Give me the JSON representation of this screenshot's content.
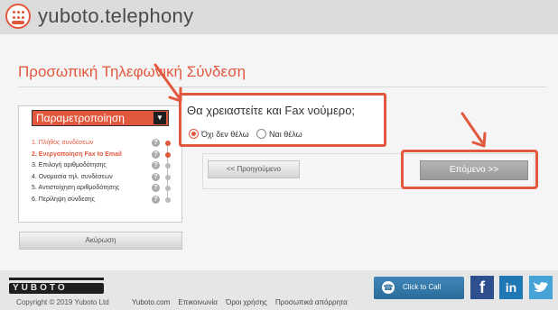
{
  "header": {
    "brand": "yuboto.telephony"
  },
  "page": {
    "title": "Προσωπική Τηλεφωνική Σύνδεση"
  },
  "sidebar": {
    "heading": "Παραμετροποίηση",
    "steps": [
      {
        "label": "1. Πλήθος συνδέσεων",
        "state": "done"
      },
      {
        "label": "2. Ενεργοποίηση Fax to Email",
        "state": "current"
      },
      {
        "label": "3. Επιλογή αριθμοδότησης",
        "state": "pending"
      },
      {
        "label": "4. Ονομασία τηλ. συνδέσεων",
        "state": "pending"
      },
      {
        "label": "5. Αντιστοίχηση αριθμοδότησης",
        "state": "pending"
      },
      {
        "label": "6. Περίληψη σύνδεσης",
        "state": "pending"
      }
    ],
    "cancel_label": "Ακύρωση"
  },
  "question": {
    "text": "Θα χρειαστείτε και Fax νούμερο;",
    "options": [
      {
        "label": "Όχι δεν θέλω",
        "selected": true
      },
      {
        "label": "Ναι θέλω",
        "selected": false
      }
    ]
  },
  "navigation": {
    "prev_label": "<< Προηγούμενο",
    "next_label": "Επόμενο >>"
  },
  "footer": {
    "logo_text": "YUBOTO",
    "copyright": "Copyright © 2019 Yuboto Ltd",
    "links": [
      "Yuboto.com",
      "Επικοινωνία",
      "Όροι χρήσης",
      "Προσωπικά απόρρητα"
    ],
    "click_to_call": "Click to Call",
    "social": {
      "facebook": "f",
      "linkedin": "in",
      "twitter": "twitter-bird-icon"
    }
  },
  "colors": {
    "accent": "#e2583e",
    "header_bg": "#dcdcdc",
    "footer_bg": "#e6e6e6"
  },
  "icons": [
    "telephone-logo-icon",
    "chevron-down-icon",
    "help-icon",
    "phone-icon",
    "facebook-icon",
    "linkedin-icon",
    "twitter-icon",
    "annotation-arrow-icon"
  ]
}
